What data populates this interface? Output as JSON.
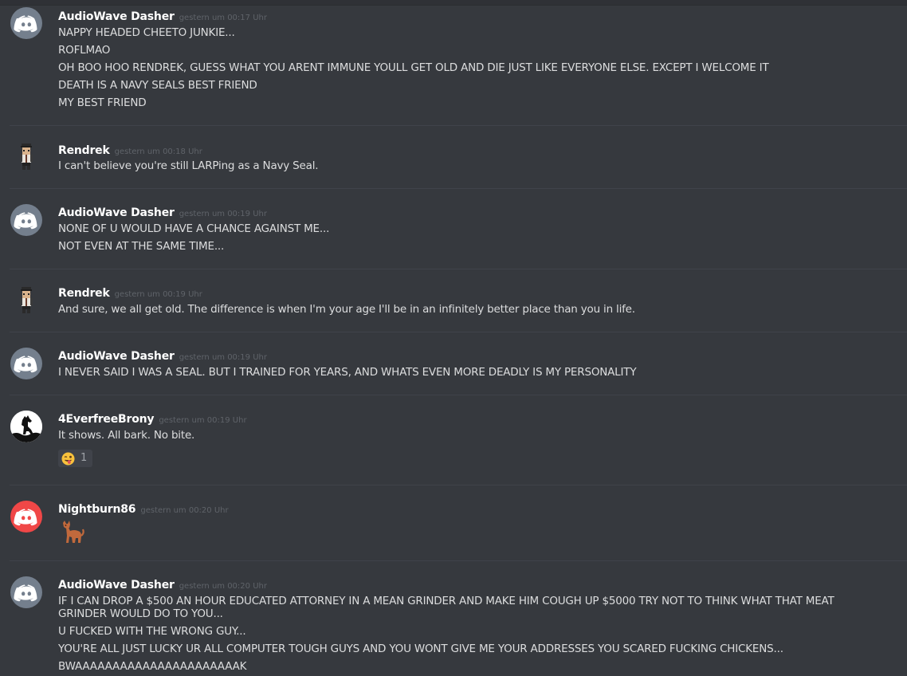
{
  "messages": [
    {
      "username": "AudioWave Dasher",
      "timestamp": "gestern um 00:17 Uhr",
      "lines": [
        "NAPPY HEADED CHEETO JUNKIE...",
        "ROFLMAO",
        "OH BOO HOO RENDREK, GUESS WHAT YOU ARENT IMMUNE YOULL GET OLD AND DIE JUST LIKE EVERYONE ELSE. EXCEPT I WELCOME IT",
        "DEATH IS A NAVY SEALS BEST FRIEND",
        "MY BEST FRIEND"
      ]
    },
    {
      "username": "Rendrek",
      "timestamp": "gestern um 00:18 Uhr",
      "lines": [
        "I can't believe you're still LARPing as a Navy Seal."
      ]
    },
    {
      "username": "AudioWave Dasher",
      "timestamp": "gestern um 00:19 Uhr",
      "lines": [
        "NONE OF U WOULD HAVE A CHANCE AGAINST ME...",
        "NOT EVEN AT THE SAME TIME..."
      ]
    },
    {
      "username": "Rendrek",
      "timestamp": "gestern um 00:19 Uhr",
      "lines": [
        "And sure, we all get old. The difference is when I'm your age I'll be in an infinitely better place than you in life."
      ]
    },
    {
      "username": "AudioWave Dasher",
      "timestamp": "gestern um 00:19 Uhr",
      "lines": [
        "I NEVER SAID I WAS A SEAL. BUT I TRAINED FOR YEARS, AND WHATS EVEN MORE DEADLY IS MY PERSONALITY"
      ]
    },
    {
      "username": "4EverfreeBrony",
      "timestamp": "gestern um 00:19 Uhr",
      "lines": [
        "It shows. All bark. No bite."
      ],
      "reaction": {
        "emoji": "stuck-out-tongue-winking-eye-emoji",
        "count": "1"
      }
    },
    {
      "username": "Nightburn86",
      "timestamp": "gestern um 00:20 Uhr",
      "emoji": "cat-emoji"
    },
    {
      "username": "AudioWave Dasher",
      "timestamp": "gestern um 00:20 Uhr",
      "lines": [
        "IF I CAN DROP A $500 AN HOUR EDUCATED ATTORNEY IN A MEAN GRINDER AND MAKE HIM COUGH UP $5000 TRY NOT TO THINK WHAT THAT MEAT",
        "GRINDER WOULD DO TO YOU...",
        "U FUCKED WITH THE WRONG GUY...",
        "YOU'RE ALL JUST LUCKY UR ALL COMPUTER TOUGH GUYS AND YOU WONT GIVE ME YOUR ADDRESSES YOU SCARED FUCKING CHICKENS...",
        "BWAAAAAAAAAAAAAAAAAAAAAAK"
      ]
    }
  ],
  "colors": {
    "background": "#36393e",
    "username": "#ffffff",
    "timestamp": "#5f6369",
    "message_text": "#dcddde",
    "divider": "#40434a",
    "discord_grey_avatar": "#747f8d",
    "discord_red_avatar": "#f04747"
  }
}
